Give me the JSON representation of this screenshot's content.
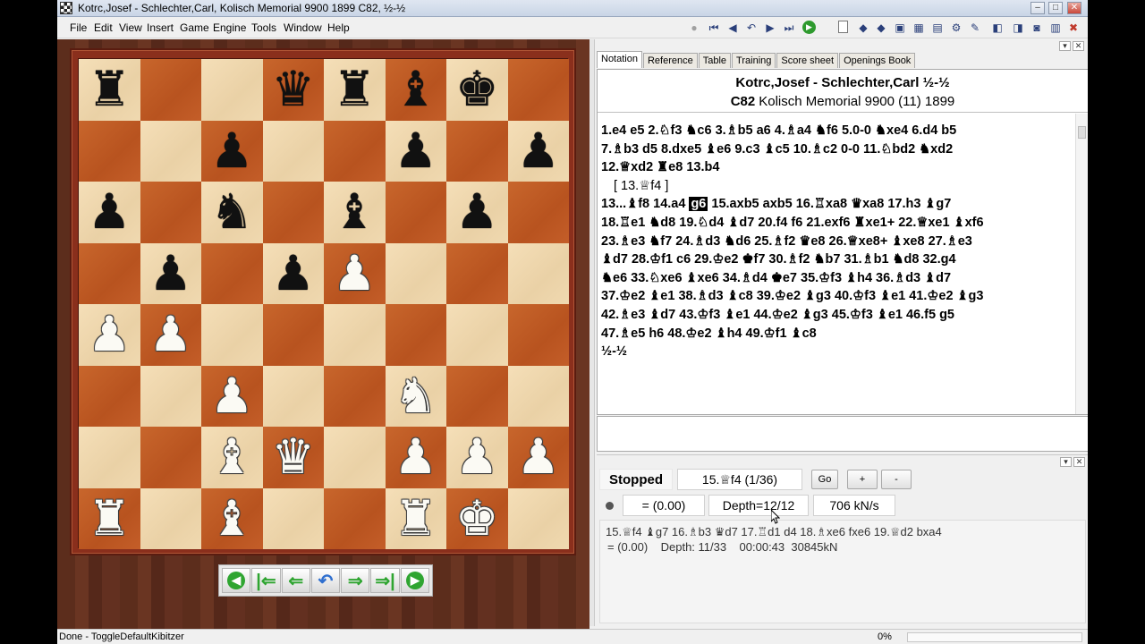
{
  "window": {
    "title": "Kotrc,Josef - Schlechter,Carl, Kolisch Memorial 9900 1899  C82, ½-½"
  },
  "menu": [
    "File",
    "Edit",
    "View",
    "Insert",
    "Game",
    "Engine",
    "Tools",
    "Window",
    "Help"
  ],
  "board": {
    "ranks": [
      [
        "br",
        "",
        "",
        "bq",
        "br",
        "bb",
        "bk",
        ""
      ],
      [
        "",
        "",
        "bp",
        "",
        "",
        "bp",
        "",
        "bp"
      ],
      [
        "bp",
        "",
        "bn",
        "",
        "bb",
        "",
        "bp",
        ""
      ],
      [
        "",
        "bp",
        "",
        "bp",
        "wp",
        "",
        "",
        ""
      ],
      [
        "wp",
        "wp",
        "",
        "",
        "",
        "",
        "",
        ""
      ],
      [
        "",
        "",
        "wp",
        "",
        "",
        "wn",
        "",
        ""
      ],
      [
        "",
        "",
        "wb",
        "wq",
        "",
        "wp",
        "wp",
        "wp"
      ],
      [
        "wr",
        "",
        "wb",
        "",
        "",
        "wr",
        "wk",
        ""
      ]
    ]
  },
  "nav_buttons": [
    "first-game",
    "first-move",
    "prev-move",
    "take-back",
    "next-move",
    "last-move",
    "next-game"
  ],
  "tabs": [
    "Notation",
    "Reference",
    "Table",
    "Training",
    "Score sheet",
    "Openings Book"
  ],
  "game_header": {
    "players": "Kotrc,Josef - Schlechter,Carl  ½-½",
    "eco": "C82",
    "event": "Kolisch Memorial 9900 (11) 1899"
  },
  "moves": {
    "l1": "1.e4  e5  2.♘f3  ♞c6  3.♗b5  a6  4.♗a4  ♞f6  5.0-0  ♞xe4  6.d4  b5",
    "l2": "7.♗b3  d5  8.dxe5  ♝e6  9.c3  ♝c5  10.♗c2  0-0  11.♘bd2  ♞xd2",
    "l3": "12.♕xd2  ♜e8  13.b4",
    "l4": "[ 13.♕f4 ]",
    "l5a": "13...♝f8  14.a4 ",
    "l5cur": "g6",
    "l5b": " 15.axb5  axb5  16.♖xa8  ♛xa8  17.h3  ♝g7",
    "l6": "18.♖e1  ♞d8  19.♘d4  ♝d7  20.f4  f6  21.exf6  ♜xe1+  22.♕xe1  ♝xf6",
    "l7": "23.♗e3  ♞f7  24.♗d3  ♞d6  25.♗f2  ♛e8  26.♕xe8+  ♝xe8  27.♗e3",
    "l8": "♝d7  28.♔f1  c6  29.♔e2  ♚f7  30.♗f2  ♞b7  31.♗b1  ♞d8  32.g4",
    "l9": "♞e6  33.♘xe6  ♝xe6  34.♗d4  ♚e7  35.♔f3  ♝h4  36.♗d3  ♝d7",
    "l10": "37.♔e2  ♝e1  38.♗d3  ♝c8  39.♔e2  ♝g3  40.♔f3  ♝e1  41.♔e2  ♝g3",
    "l11": "42.♗e3  ♝d7  43.♔f3  ♝e1  44.♔e2  ♝g3  45.♔f3  ♝e1  46.f5  g5",
    "l12": "47.♗e5  h6  48.♔e2  ♝h4  49.♔f1  ♝c8",
    "l13": "½-½"
  },
  "engine": {
    "state": "Stopped",
    "best_move": "15.♕f4 (1/36)",
    "go": "Go",
    "plus": "+",
    "minus": "-",
    "eval": "= (0.00)",
    "depth": "Depth=12/12",
    "speed": "706 kN/s",
    "pv": "15.♕f4 ♝g7 16.♗b3 ♛d7 17.♖d1 d4 18.♗xe6 fxe6 19.♕d2 bxa4",
    "info": "= (0.00)    Depth: 11/33    00:00:43  30845kN"
  },
  "status": {
    "text": "Done - ToggleDefaultKibitzer",
    "progress": "0%"
  }
}
